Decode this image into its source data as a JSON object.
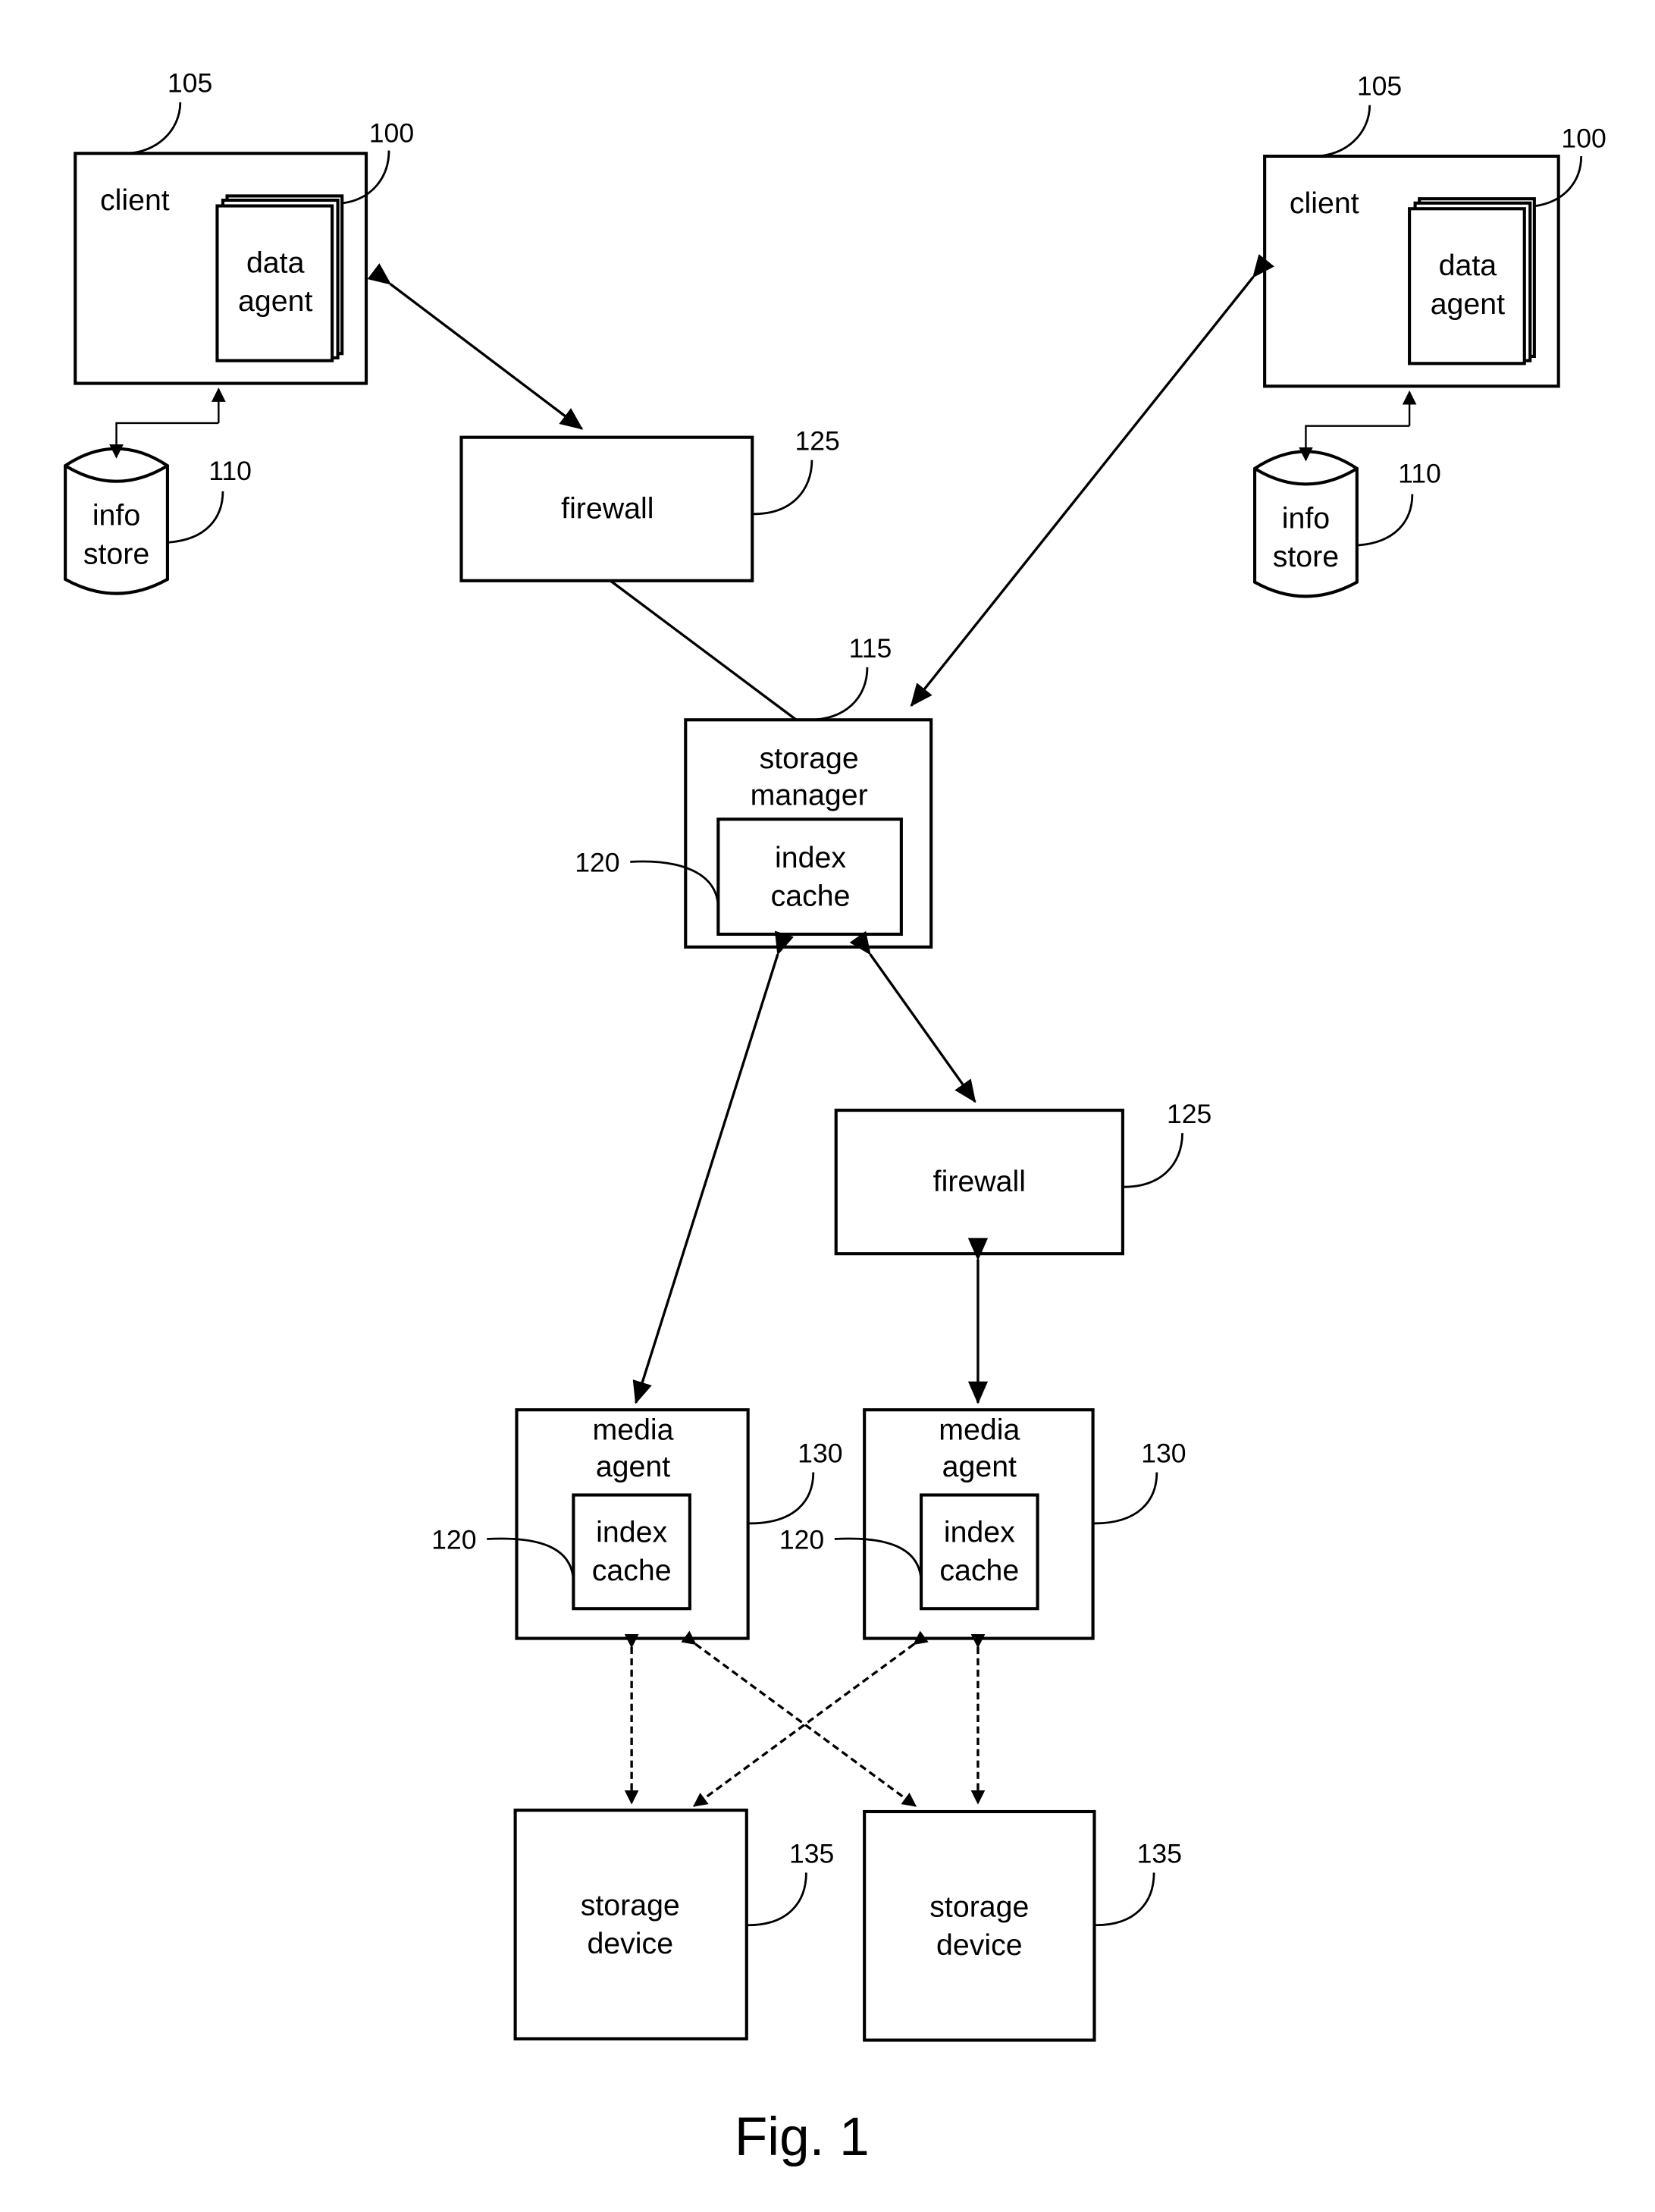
{
  "diagram": {
    "figure_caption": "Fig. 1",
    "clients": [
      {
        "label": "client",
        "ref": "105",
        "agent_line1": "data",
        "agent_line2": "agent",
        "agent_ref": "100",
        "store_line1": "info",
        "store_line2": "store",
        "store_ref": "110"
      },
      {
        "label": "client",
        "ref": "105",
        "agent_line1": "data",
        "agent_line2": "agent",
        "agent_ref": "100",
        "store_line1": "info",
        "store_line2": "store",
        "store_ref": "110"
      }
    ],
    "firewalls": [
      {
        "label": "firewall",
        "ref": "125"
      },
      {
        "label": "firewall",
        "ref": "125"
      }
    ],
    "storage_manager": {
      "line1": "storage",
      "line2": "manager",
      "ref": "115",
      "cache_line1": "index",
      "cache_line2": "cache",
      "cache_ref": "120"
    },
    "media_agents": [
      {
        "line1": "media",
        "line2": "agent",
        "ref": "130",
        "cache_line1": "index",
        "cache_line2": "cache",
        "cache_ref": "120"
      },
      {
        "line1": "media",
        "line2": "agent",
        "ref": "130",
        "cache_line1": "index",
        "cache_line2": "cache",
        "cache_ref": "120"
      }
    ],
    "storage_devices": [
      {
        "line1": "storage",
        "line2": "device",
        "ref": "135"
      },
      {
        "line1": "storage",
        "line2": "device",
        "ref": "135"
      }
    ]
  }
}
